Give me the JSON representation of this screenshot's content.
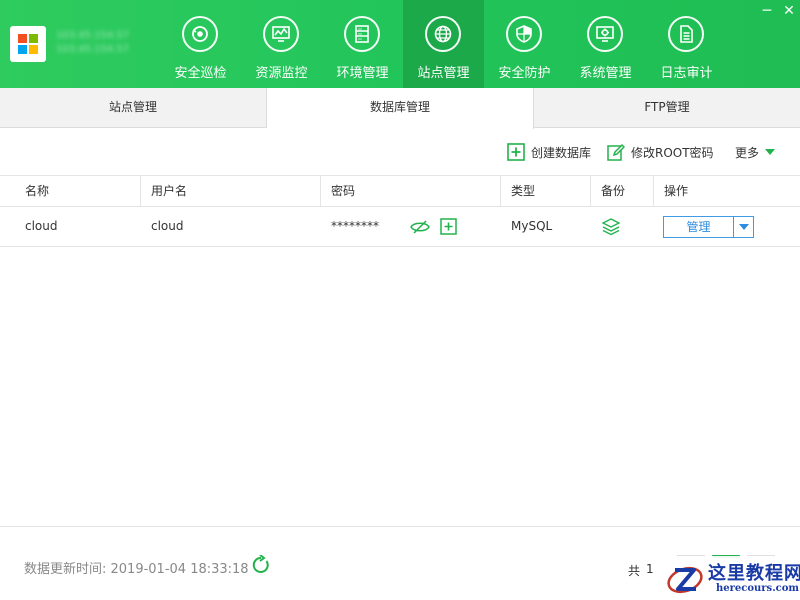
{
  "server": {
    "line1": "103.45.154.57",
    "line2": "103.45.154.57"
  },
  "nav": [
    {
      "label": "安全巡检",
      "icon": "shield-scan-icon"
    },
    {
      "label": "资源监控",
      "icon": "monitor-chart-icon"
    },
    {
      "label": "环境管理",
      "icon": "server-rack-icon"
    },
    {
      "label": "站点管理",
      "icon": "globe-icon",
      "active": true
    },
    {
      "label": "安全防护",
      "icon": "shield-icon"
    },
    {
      "label": "系统管理",
      "icon": "gear-display-icon"
    },
    {
      "label": "日志审计",
      "icon": "document-icon"
    }
  ],
  "window": {
    "minimize": "─",
    "close": "✕"
  },
  "subtabs": [
    {
      "label": "站点管理"
    },
    {
      "label": "数据库管理",
      "active": true
    },
    {
      "label": "FTP管理"
    }
  ],
  "toolbar": {
    "create_label": "创建数据库",
    "root_label": "修改ROOT密码",
    "more_label": "更多"
  },
  "table": {
    "headers": [
      "名称",
      "用户名",
      "密码",
      "类型",
      "备份",
      "操作"
    ],
    "rows": [
      {
        "name": "cloud",
        "user": "cloud",
        "password": "********",
        "type": "MySQL",
        "action": "管理"
      }
    ]
  },
  "footer": {
    "update_text": "数据更新时间: 2019-01-04 18:33:18",
    "pager_prefix": "共",
    "pager_total": "1"
  },
  "watermark": {
    "title": "这里教程网",
    "sub": "herecours.com"
  },
  "colors": {
    "brand_green": "#22c55a",
    "active_green": "#1ca94a",
    "link_blue": "#2d8de0"
  }
}
